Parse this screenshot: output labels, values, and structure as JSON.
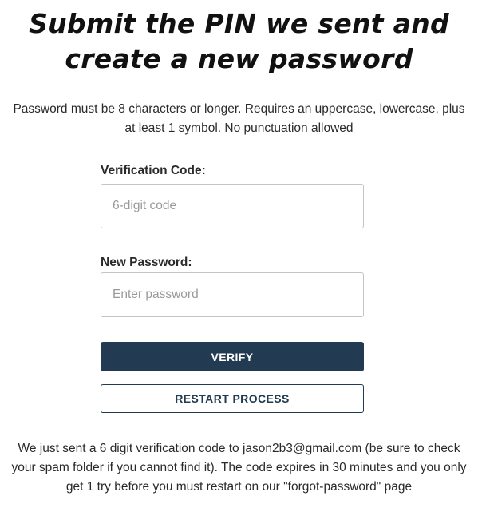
{
  "heading": {
    "line1": "Submit the PIN we sent and",
    "line2": "create a new password"
  },
  "password_rules": "Password must be 8 characters or longer. Requires an uppercase, lowercase, plus at least 1 symbol. No punctuation allowed",
  "form": {
    "verification_code": {
      "label": "Verification Code:",
      "placeholder": "6-digit code",
      "value": ""
    },
    "new_password": {
      "label": "New Password:",
      "placeholder": "Enter password",
      "value": ""
    },
    "verify_button": "VERIFY",
    "restart_button": "RESTART PROCESS"
  },
  "footer_note": "We just sent a 6 digit verification code to jason2b3@gmail.com (be sure to check your spam folder if you cannot find it). The code expires in 30 minutes and you only get 1 try before you must restart on our \"forgot-password\" page",
  "colors": {
    "primary": "#223a52",
    "text": "#2a2a2a",
    "border": "#c4c4c4"
  }
}
